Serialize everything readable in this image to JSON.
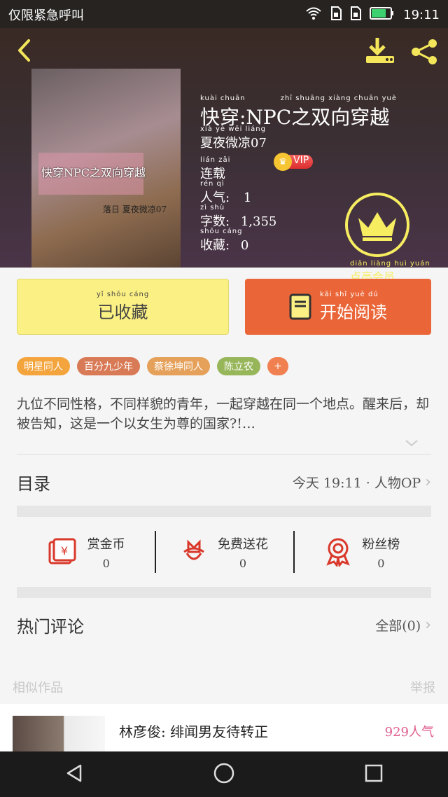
{
  "status_bar": {
    "left_text": "仅限紧急呼叫",
    "time": "19:11"
  },
  "book": {
    "title": "快穿:NPC之双向穿越",
    "cover_title": "快穿NPC之双向穿越",
    "cover_signature": "落日 夏夜微凉07",
    "author": "夏夜微凉07",
    "vip_label": "VIP",
    "status": "连载",
    "popularity_label": "人气:",
    "popularity_value": "1",
    "word_count_label": "字数:",
    "word_count_value": "1,355",
    "favorites_label": "收藏:",
    "favorites_value": "0",
    "member_badge_label": "点亮会员"
  },
  "actions": {
    "collected_label": "已收藏",
    "read_label": "开始阅读"
  },
  "tags": [
    {
      "label": "明星同人",
      "color": "#f4a43c"
    },
    {
      "label": "百分九少年",
      "color": "#d87a55"
    },
    {
      "label": "蔡徐坤同人",
      "color": "#e5a05a"
    },
    {
      "label": "陈立农",
      "color": "#97b65a"
    },
    {
      "label": "+",
      "color": "#f08050"
    }
  ],
  "description": "九位不同性格，不同样貌的青年，一起穿越在同一个地点。醒来后，却被告知，这是一个以女生为尊的国家?!…",
  "catalog": {
    "label": "目录",
    "meta": "今天 19:11 · 人物OP"
  },
  "stats": [
    {
      "icon": "reward-coin-icon",
      "label": "赏金币",
      "value": "0"
    },
    {
      "icon": "flower-icon",
      "label": "免费送花",
      "value": "0"
    },
    {
      "icon": "ribbon-badge-icon",
      "label": "粉丝榜",
      "value": "0"
    }
  ],
  "comments": {
    "label": "热门评论",
    "meta": "全部(0)"
  },
  "footer": {
    "similar_label": "相似作品",
    "report_label": "举报"
  },
  "banner": {
    "text": "林彦俊: 绯闻男友待转正",
    "popularity": "929人气"
  },
  "colors": {
    "accent_orange": "#ea6638",
    "accent_yellow": "#fbf084",
    "badge_yellow": "#f7ed61"
  }
}
